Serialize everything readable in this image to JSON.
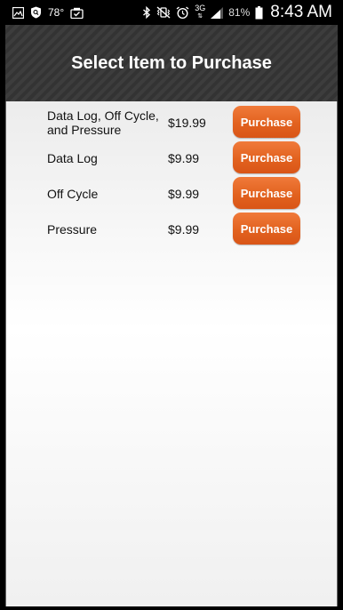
{
  "status_bar": {
    "temperature": "78°",
    "network": "3G",
    "battery_percent": "81%",
    "time": "8:43 AM"
  },
  "header": {
    "title": "Select Item to Purchase"
  },
  "items": [
    {
      "name": "Data Log, Off Cycle, and Pressure",
      "price": "$19.99",
      "button_label": "Purchase"
    },
    {
      "name": "Data Log",
      "price": "$9.99",
      "button_label": "Purchase"
    },
    {
      "name": "Off Cycle",
      "price": "$9.99",
      "button_label": "Purchase"
    },
    {
      "name": "Pressure",
      "price": "$9.99",
      "button_label": "Purchase"
    }
  ],
  "colors": {
    "accent": "#e8661f",
    "header_bg": "#3a3a3a"
  }
}
